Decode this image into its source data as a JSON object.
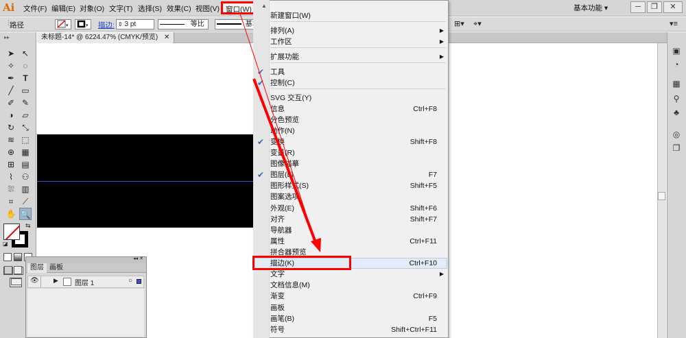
{
  "menubar": {
    "logo": "Ai",
    "items": [
      "文件(F)",
      "编辑(E)",
      "对象(O)",
      "文字(T)",
      "选择(S)",
      "效果(C)",
      "视图(V)",
      "窗口(W)"
    ],
    "workspace": "基本功能"
  },
  "controlbar": {
    "object_label": "路径",
    "stroke_label": "描边:",
    "stroke_weight": "3 pt",
    "profile_label": "等比",
    "brush_label": "基本"
  },
  "document": {
    "tab_title": "未标题-14* @ 6224.47% (CMYK/预览)"
  },
  "layers_panel": {
    "tabs": [
      "图层",
      "画板"
    ],
    "layer_name": "图层 1"
  },
  "window_menu": {
    "items": [
      {
        "label": "新建窗口(W)",
        "shortcut": "",
        "submenu": false,
        "checked": false
      },
      {
        "label": "排列(A)",
        "shortcut": "",
        "submenu": true,
        "checked": false
      },
      {
        "label": "工作区",
        "shortcut": "",
        "submenu": true,
        "checked": false
      },
      {
        "label": "扩展功能",
        "shortcut": "",
        "submenu": true,
        "checked": false
      },
      {
        "label": "工具",
        "shortcut": "",
        "submenu": false,
        "checked": true
      },
      {
        "label": "控制(C)",
        "shortcut": "",
        "submenu": false,
        "checked": true
      },
      {
        "label": "SVG 交互(Y)",
        "shortcut": "",
        "submenu": false,
        "checked": false
      },
      {
        "label": "信息",
        "shortcut": "Ctrl+F8",
        "submenu": false,
        "checked": false
      },
      {
        "label": "分色预览",
        "shortcut": "",
        "submenu": false,
        "checked": false
      },
      {
        "label": "动作(N)",
        "shortcut": "",
        "submenu": false,
        "checked": false
      },
      {
        "label": "变换",
        "shortcut": "Shift+F8",
        "submenu": false,
        "checked": true
      },
      {
        "label": "变量(R)",
        "shortcut": "",
        "submenu": false,
        "checked": false
      },
      {
        "label": "图像描摹",
        "shortcut": "",
        "submenu": false,
        "checked": false
      },
      {
        "label": "图层(L)",
        "shortcut": "F7",
        "submenu": false,
        "checked": true
      },
      {
        "label": "图形样式(S)",
        "shortcut": "Shift+F5",
        "submenu": false,
        "checked": false
      },
      {
        "label": "图案选项",
        "shortcut": "",
        "submenu": false,
        "checked": false
      },
      {
        "label": "外观(E)",
        "shortcut": "Shift+F6",
        "submenu": false,
        "checked": false
      },
      {
        "label": "对齐",
        "shortcut": "Shift+F7",
        "submenu": false,
        "checked": false
      },
      {
        "label": "导航器",
        "shortcut": "",
        "submenu": false,
        "checked": false
      },
      {
        "label": "属性",
        "shortcut": "Ctrl+F11",
        "submenu": false,
        "checked": false
      },
      {
        "label": "拼合器预览",
        "shortcut": "",
        "submenu": false,
        "checked": false
      },
      {
        "label": "描边(K)",
        "shortcut": "Ctrl+F10",
        "submenu": false,
        "checked": false
      },
      {
        "label": "文字",
        "shortcut": "",
        "submenu": true,
        "checked": false
      },
      {
        "label": "文档信息(M)",
        "shortcut": "",
        "submenu": false,
        "checked": false
      },
      {
        "label": "渐变",
        "shortcut": "Ctrl+F9",
        "submenu": false,
        "checked": false
      },
      {
        "label": "画板",
        "shortcut": "",
        "submenu": false,
        "checked": false
      },
      {
        "label": "画笔(B)",
        "shortcut": "F5",
        "submenu": false,
        "checked": false
      },
      {
        "label": "符号",
        "shortcut": "Shift+Ctrl+F11",
        "submenu": false,
        "checked": false
      }
    ]
  },
  "colors": {
    "highlight_red": "#ff0000",
    "check_blue": "#3a63c2",
    "guide_blue": "#3e4fd6"
  }
}
